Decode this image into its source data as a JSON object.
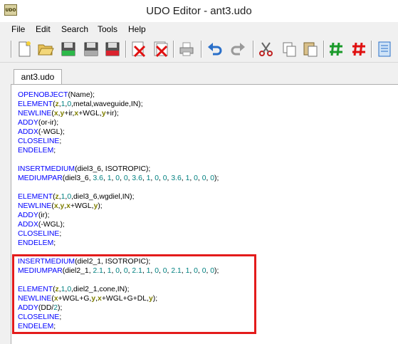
{
  "window": {
    "title": "UDO Editor - ant3.udo",
    "app_icon_text": "UDO"
  },
  "menu": [
    "File",
    "Edit",
    "Search",
    "Tools",
    "Help"
  ],
  "toolbar": {
    "buttons": [
      "new-file-icon",
      "open-folder-icon",
      "save-icon",
      "save-as-icon",
      "save-all-icon",
      "delete-icon",
      "delete-all-icon",
      "print-icon",
      "undo-icon",
      "redo-icon",
      "cut-icon",
      "copy-icon",
      "paste-icon",
      "comment-icon",
      "uncomment-icon",
      "document-icon"
    ]
  },
  "tab": {
    "label": "ant3.udo"
  },
  "colors": {
    "keyword": "#0000ff",
    "variable": "#808000",
    "number": "#008080",
    "highlight": "#e31b1b"
  },
  "code_lines": [
    [
      [
        "kw",
        "OPENOBJECT"
      ],
      [
        "txt",
        "(Name);"
      ]
    ],
    [
      [
        "kw",
        "ELEMENT"
      ],
      [
        "txt",
        "("
      ],
      [
        "var",
        "z"
      ],
      [
        "txt",
        ","
      ],
      [
        "num",
        "1"
      ],
      [
        "txt",
        ","
      ],
      [
        "num",
        "0"
      ],
      [
        "txt",
        ",metal,waveguide,IN);"
      ]
    ],
    [
      [
        "kw",
        "NEWLINE"
      ],
      [
        "txt",
        "("
      ],
      [
        "var",
        "x"
      ],
      [
        "txt",
        ","
      ],
      [
        "var",
        "y"
      ],
      [
        "txt",
        "+ir,"
      ],
      [
        "var",
        "x"
      ],
      [
        "txt",
        "+WGL,"
      ],
      [
        "var",
        "y"
      ],
      [
        "txt",
        "+ir);"
      ]
    ],
    [
      [
        "kw",
        "ADDY"
      ],
      [
        "txt",
        "(or-ir);"
      ]
    ],
    [
      [
        "kw",
        "ADDX"
      ],
      [
        "txt",
        "(-WGL);"
      ]
    ],
    [
      [
        "kw",
        "CLOSELINE"
      ],
      [
        "txt",
        ";"
      ]
    ],
    [
      [
        "kw",
        "ENDELEM"
      ],
      [
        "txt",
        ";"
      ]
    ],
    [],
    [
      [
        "kw",
        "INSERTMEDIUM"
      ],
      [
        "txt",
        "(diel3_6, ISOTROPIC);"
      ]
    ],
    [
      [
        "kw",
        "MEDIUMPAR"
      ],
      [
        "txt",
        "(diel3_6, "
      ],
      [
        "num",
        "3.6"
      ],
      [
        "txt",
        ", "
      ],
      [
        "num",
        "1"
      ],
      [
        "txt",
        ", "
      ],
      [
        "num",
        "0"
      ],
      [
        "txt",
        ", "
      ],
      [
        "num",
        "0"
      ],
      [
        "txt",
        ", "
      ],
      [
        "num",
        "3.6"
      ],
      [
        "txt",
        ", "
      ],
      [
        "num",
        "1"
      ],
      [
        "txt",
        ", "
      ],
      [
        "num",
        "0"
      ],
      [
        "txt",
        ", "
      ],
      [
        "num",
        "0"
      ],
      [
        "txt",
        ", "
      ],
      [
        "num",
        "3.6"
      ],
      [
        "txt",
        ", "
      ],
      [
        "num",
        "1"
      ],
      [
        "txt",
        ", "
      ],
      [
        "num",
        "0"
      ],
      [
        "txt",
        ", "
      ],
      [
        "num",
        "0"
      ],
      [
        "txt",
        ", "
      ],
      [
        "num",
        "0"
      ],
      [
        "txt",
        ");"
      ]
    ],
    [],
    [
      [
        "kw",
        "ELEMENT"
      ],
      [
        "txt",
        "("
      ],
      [
        "var",
        "z"
      ],
      [
        "txt",
        ","
      ],
      [
        "num",
        "1"
      ],
      [
        "txt",
        ","
      ],
      [
        "num",
        "0"
      ],
      [
        "txt",
        ",diel3_6,wgdiel,IN);"
      ]
    ],
    [
      [
        "kw",
        "NEWLINE"
      ],
      [
        "txt",
        "("
      ],
      [
        "var",
        "x"
      ],
      [
        "txt",
        ","
      ],
      [
        "var",
        "y"
      ],
      [
        "txt",
        ","
      ],
      [
        "var",
        "x"
      ],
      [
        "txt",
        "+WGL,"
      ],
      [
        "var",
        "y"
      ],
      [
        "txt",
        ");"
      ]
    ],
    [
      [
        "kw",
        "ADDY"
      ],
      [
        "txt",
        "(ir);"
      ]
    ],
    [
      [
        "kw",
        "ADDX"
      ],
      [
        "txt",
        "(-WGL);"
      ]
    ],
    [
      [
        "kw",
        "CLOSELINE"
      ],
      [
        "txt",
        ";"
      ]
    ],
    [
      [
        "kw",
        "ENDELEM"
      ],
      [
        "txt",
        ";"
      ]
    ],
    [],
    [
      [
        "kw",
        "INSERTMEDIUM"
      ],
      [
        "txt",
        "(diel2_1, ISOTROPIC);"
      ]
    ],
    [
      [
        "kw",
        "MEDIUMPAR"
      ],
      [
        "txt",
        "(diel2_1, "
      ],
      [
        "num",
        "2.1"
      ],
      [
        "txt",
        ", "
      ],
      [
        "num",
        "1"
      ],
      [
        "txt",
        ", "
      ],
      [
        "num",
        "0"
      ],
      [
        "txt",
        ", "
      ],
      [
        "num",
        "0"
      ],
      [
        "txt",
        ", "
      ],
      [
        "num",
        "2.1"
      ],
      [
        "txt",
        ", "
      ],
      [
        "num",
        "1"
      ],
      [
        "txt",
        ", "
      ],
      [
        "num",
        "0"
      ],
      [
        "txt",
        ", "
      ],
      [
        "num",
        "0"
      ],
      [
        "txt",
        ", "
      ],
      [
        "num",
        "2.1"
      ],
      [
        "txt",
        ", "
      ],
      [
        "num",
        "1"
      ],
      [
        "txt",
        ", "
      ],
      [
        "num",
        "0"
      ],
      [
        "txt",
        ", "
      ],
      [
        "num",
        "0"
      ],
      [
        "txt",
        ", "
      ],
      [
        "num",
        "0"
      ],
      [
        "txt",
        ");"
      ]
    ],
    [],
    [
      [
        "kw",
        "ELEMENT"
      ],
      [
        "txt",
        "("
      ],
      [
        "var",
        "z"
      ],
      [
        "txt",
        ","
      ],
      [
        "num",
        "1"
      ],
      [
        "txt",
        ","
      ],
      [
        "num",
        "0"
      ],
      [
        "txt",
        ",diel2_1,cone,IN);"
      ]
    ],
    [
      [
        "kw",
        "NEWLINE"
      ],
      [
        "txt",
        "("
      ],
      [
        "var",
        "x"
      ],
      [
        "txt",
        "+WGL+G,"
      ],
      [
        "var",
        "y"
      ],
      [
        "txt",
        ","
      ],
      [
        "var",
        "x"
      ],
      [
        "txt",
        "+WGL+G+DL,"
      ],
      [
        "var",
        "y"
      ],
      [
        "txt",
        ");"
      ]
    ],
    [
      [
        "kw",
        "ADDY"
      ],
      [
        "txt",
        "(DD/"
      ],
      [
        "num",
        "2"
      ],
      [
        "txt",
        ");"
      ]
    ],
    [
      [
        "kw",
        "CLOSELINE"
      ],
      [
        "txt",
        ";"
      ]
    ],
    [
      [
        "kw",
        "ENDELEM"
      ],
      [
        "txt",
        ";"
      ]
    ]
  ]
}
